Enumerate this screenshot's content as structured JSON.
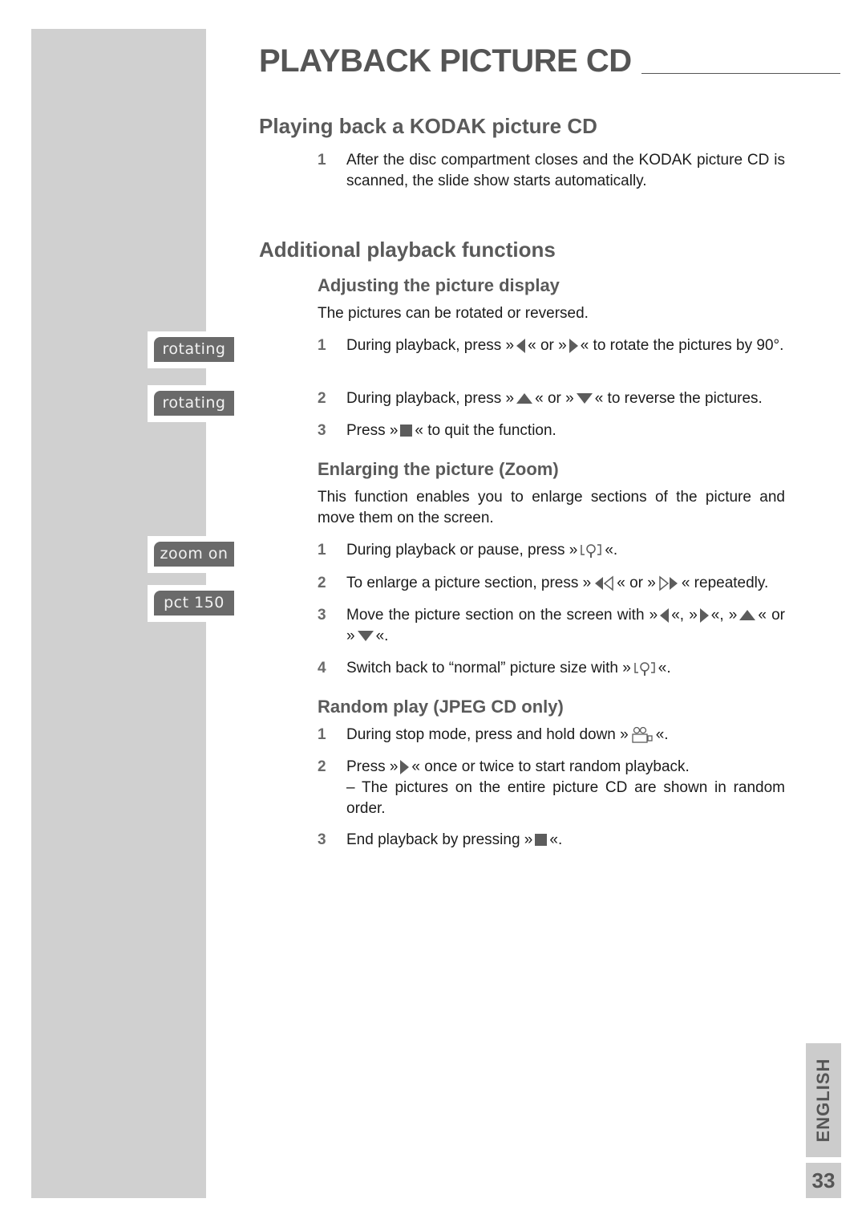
{
  "header": {
    "title": "PLAYBACK PICTURE CD"
  },
  "sidebar": {
    "badges": [
      {
        "label": "rotating"
      },
      {
        "label": "rotating"
      },
      {
        "label": "zoom on"
      },
      {
        "label": "pct 150"
      }
    ]
  },
  "section1": {
    "heading": "Playing back a KODAK picture CD",
    "steps": [
      {
        "num": "1",
        "text": "After the disc compartment closes and the KODAK picture CD is scanned, the slide show starts automatically."
      }
    ]
  },
  "section2": {
    "heading": "Additional playback functions",
    "adjust": {
      "heading": "Adjusting the picture display",
      "intro": "The pictures can be rotated or reversed.",
      "steps": [
        {
          "num": "1",
          "a": "During playback, press »",
          "b": "« or »",
          "c": "« to rotate the pictures by 90°."
        },
        {
          "num": "2",
          "a": "During playback, press »",
          "b": "« or »",
          "c": "« to reverse the pictures."
        },
        {
          "num": "3",
          "a": "Press »",
          "c": "« to quit the function."
        }
      ]
    },
    "zoom": {
      "heading": "Enlarging the picture (Zoom)",
      "intro": "This function enables you to enlarge sections of the picture and move them on the screen.",
      "steps": [
        {
          "num": "1",
          "a": "During playback or pause, press »",
          "c": "«."
        },
        {
          "num": "2",
          "a": "To enlarge a picture section, press »",
          "b": "« or »",
          "c": "« repeatedly."
        },
        {
          "num": "3",
          "a": "Move the picture section on the screen with »",
          "b": "«, »",
          "c": "«, »",
          "d": "« or »",
          "e": "«."
        },
        {
          "num": "4",
          "a": "Switch back to “normal” picture size with »",
          "c": "«."
        }
      ]
    },
    "random": {
      "heading": "Random play (JPEG CD only)",
      "steps": [
        {
          "num": "1",
          "a": "During stop mode, press and hold down »",
          "c": "«."
        },
        {
          "num": "2",
          "a": "Press »",
          "c": "« once or twice to start random playback.",
          "sub": "– The pictures on the entire picture CD are shown in random order."
        },
        {
          "num": "3",
          "a": "End playback by pressing »",
          "c": "«."
        }
      ]
    }
  },
  "footer": {
    "language": "ENGLISH",
    "page_number": "33"
  }
}
